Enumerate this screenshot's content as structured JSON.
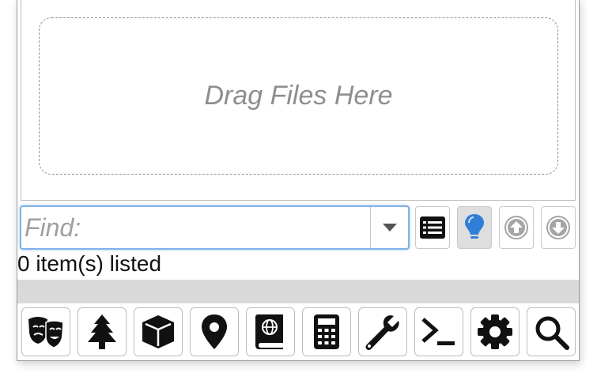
{
  "drop_zone": {
    "text": "Drag Files Here"
  },
  "find": {
    "placeholder": "Find:",
    "value": ""
  },
  "status": {
    "count_text": "0 item(s) listed"
  },
  "colors": {
    "focus_border": "#7fb2e6",
    "bulb_accent": "#2f7fd6"
  },
  "toolbar": [
    {
      "name": "list-view-icon"
    },
    {
      "name": "lightbulb-icon"
    },
    {
      "name": "arrow-up-circle-icon"
    },
    {
      "name": "arrow-down-circle-icon"
    }
  ],
  "dock": [
    {
      "name": "theater-masks-icon"
    },
    {
      "name": "tree-icon"
    },
    {
      "name": "cube-icon"
    },
    {
      "name": "map-pin-icon"
    },
    {
      "name": "globe-book-icon"
    },
    {
      "name": "calculator-icon"
    },
    {
      "name": "wrench-icon"
    },
    {
      "name": "terminal-icon"
    },
    {
      "name": "gear-icon"
    },
    {
      "name": "search-icon"
    }
  ]
}
